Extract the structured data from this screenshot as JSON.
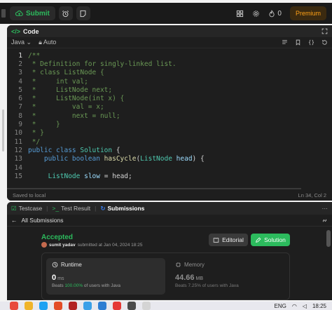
{
  "topbar": {
    "submit_label": "Submit",
    "streak_count": "0",
    "premium_label": "Premium"
  },
  "code_panel": {
    "title": "Code",
    "language": "Java",
    "mode": "Auto",
    "lines": [
      {
        "n": "1",
        "tokens": [
          {
            "t": "/**",
            "c": "com"
          }
        ]
      },
      {
        "n": "2",
        "tokens": [
          {
            "t": " * Definition for singly-linked list.",
            "c": "com"
          }
        ]
      },
      {
        "n": "3",
        "tokens": [
          {
            "t": " * class ListNode {",
            "c": "com"
          }
        ]
      },
      {
        "n": "4",
        "tokens": [
          {
            "t": " *     int val;",
            "c": "com"
          }
        ]
      },
      {
        "n": "5",
        "tokens": [
          {
            "t": " *     ListNode next;",
            "c": "com"
          }
        ]
      },
      {
        "n": "6",
        "tokens": [
          {
            "t": " *     ListNode(int x) {",
            "c": "com"
          }
        ]
      },
      {
        "n": "7",
        "tokens": [
          {
            "t": " *         val = x;",
            "c": "com"
          }
        ]
      },
      {
        "n": "8",
        "tokens": [
          {
            "t": " *         next = null;",
            "c": "com"
          }
        ]
      },
      {
        "n": "9",
        "tokens": [
          {
            "t": " *     }",
            "c": "com"
          }
        ]
      },
      {
        "n": "10",
        "tokens": [
          {
            "t": " * }",
            "c": "com"
          }
        ]
      },
      {
        "n": "11",
        "tokens": [
          {
            "t": " */",
            "c": "com"
          }
        ]
      },
      {
        "n": "12",
        "tokens": [
          {
            "t": "public class ",
            "c": "kw"
          },
          {
            "t": "Solution",
            "c": "ty"
          },
          {
            "t": " {",
            "c": ""
          }
        ]
      },
      {
        "n": "13",
        "tokens": [
          {
            "t": "    public boolean ",
            "c": "kw"
          },
          {
            "t": "hasCycle",
            "c": "fn"
          },
          {
            "t": "(",
            "c": ""
          },
          {
            "t": "ListNode",
            "c": "ty"
          },
          {
            "t": " head",
            "c": "var"
          },
          {
            "t": ") {",
            "c": ""
          }
        ]
      },
      {
        "n": "14",
        "tokens": [
          {
            "t": "",
            "c": ""
          }
        ]
      },
      {
        "n": "15",
        "tokens": [
          {
            "t": "     ",
            "c": ""
          },
          {
            "t": "ListNode",
            "c": "ty"
          },
          {
            "t": " slow",
            "c": "var"
          },
          {
            "t": " = head;",
            "c": ""
          }
        ]
      }
    ],
    "status_left": "Saved to local",
    "status_right": "Ln 34, Col 2"
  },
  "result_panel": {
    "tabs": [
      {
        "label": "Testcase"
      },
      {
        "label": "Test Result"
      },
      {
        "label": "Submissions"
      }
    ],
    "all_submissions_label": "All Submissions",
    "status": "Accepted",
    "username": "sumit yadav",
    "submitted_text": "submitted at Jan 04, 2024 18:25",
    "editorial_label": "Editorial",
    "solution_label": "Solution",
    "runtime": {
      "title": "Runtime",
      "value": "0",
      "unit": "ms",
      "beats_prefix": "Beats",
      "beats_pct": "100.00%",
      "beats_suffix": "of users with Java"
    },
    "memory": {
      "title": "Memory",
      "value": "44.66",
      "unit": "MB",
      "beats_prefix": "Beats",
      "beats_pct": "7.25%",
      "beats_suffix": "of users with Java"
    }
  },
  "taskbar": {
    "lang": "ENG",
    "time": "18:25"
  }
}
